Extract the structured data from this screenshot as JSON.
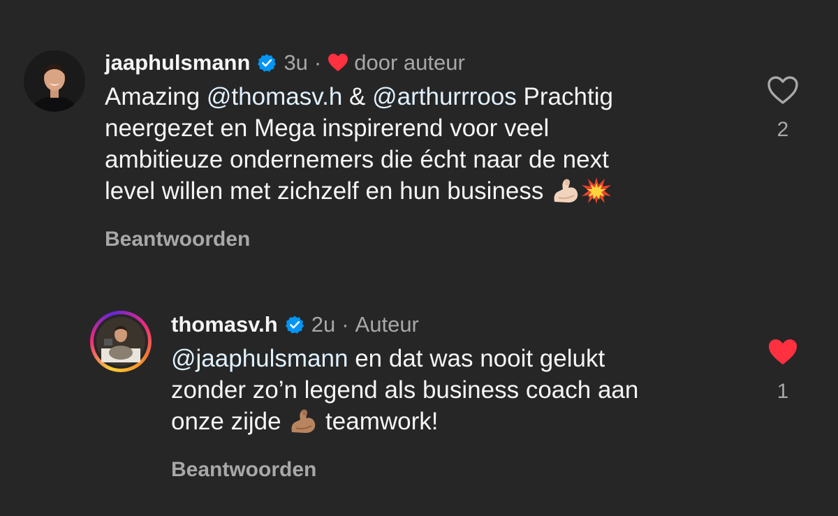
{
  "comments": [
    {
      "username": "jaaphulsmann",
      "time": "3u",
      "separator": "·",
      "liked_by_author_label": "door auteur",
      "text_lines": {
        "l1_mention1": "@thomasv.h",
        "l1_amazing": "Amazing ",
        "l1_amp": " & ",
        "l1_mention2": "@arthurrroos",
        "l1_rest": " Prachtig",
        "l2": "neergezet en Mega inspirerend voor veel",
        "l3": "ambitieuze ondernemers die écht naar de next",
        "l4": "level willen met zichzelf en hun business "
      },
      "reply_label": "Beantwoorden",
      "like_count": "2",
      "liked": false
    },
    {
      "username": "thomasv.h",
      "time": "2u",
      "separator": "·",
      "author_label": "Auteur",
      "text_lines": {
        "l1_mention": "@jaaphulsmann",
        "l1_rest": " en dat was nooit gelukt",
        "l2": "zonder zo’n legend als business coach aan",
        "l3_a": "onze zijde ",
        "l3_b": " teamwork!"
      },
      "reply_label": "Beantwoorden",
      "like_count": "1",
      "liked": true
    }
  ],
  "colors": {
    "background": "#262626",
    "text": "#f5f5f5",
    "secondary": "#a8a8a8",
    "mention": "#e0f1ff",
    "verified": "#0095f6",
    "like_red": "#ff3040"
  },
  "icons": {
    "verified": "verified-badge-icon",
    "heart_outline": "heart-outline-icon",
    "heart_filled": "heart-filled-icon",
    "muscle_emoji": "flexed-biceps-emoji",
    "collision_emoji": "collision-emoji"
  }
}
